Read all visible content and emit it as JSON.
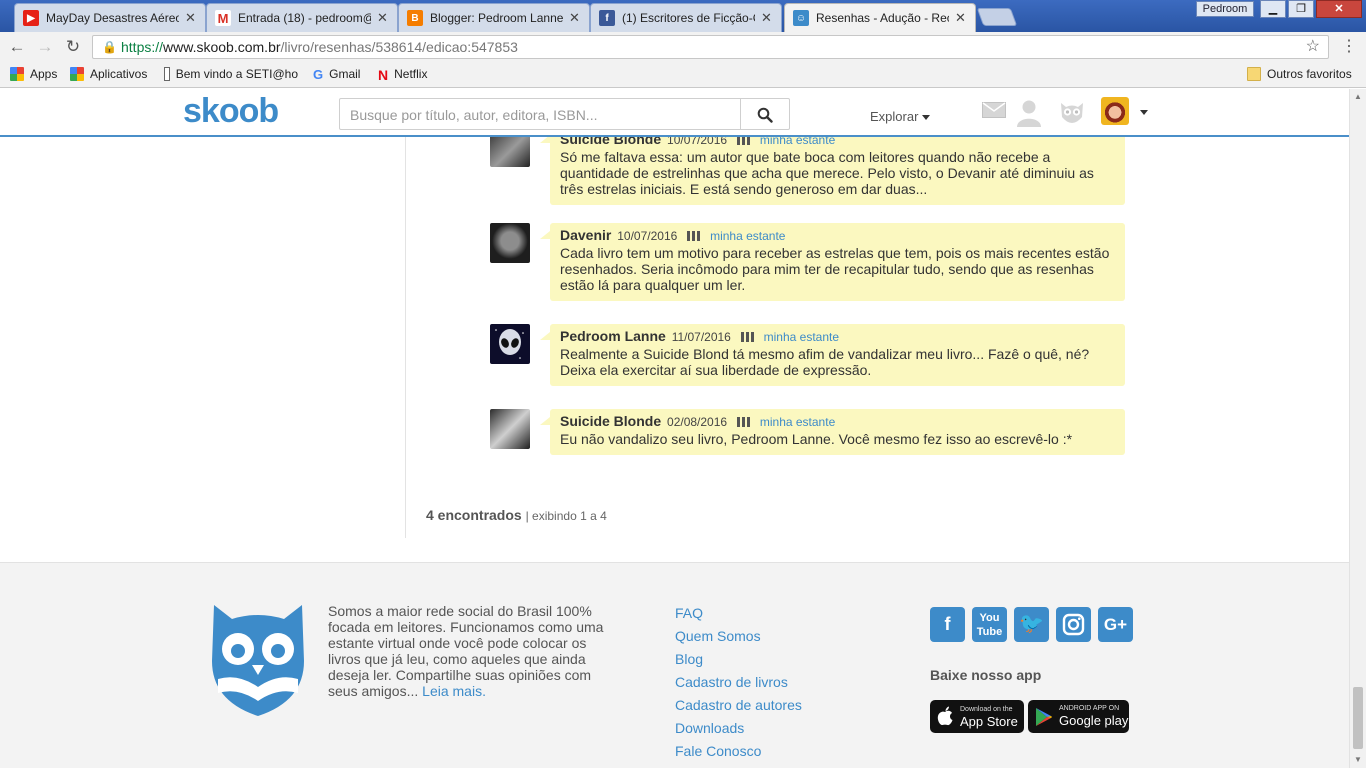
{
  "browser": {
    "tabs": [
      {
        "title": "MayDay Desastres Aéreo",
        "favicon_color": "#e62117",
        "favicon_glyph": "▶"
      },
      {
        "title": "Entrada (18) - pedroom@",
        "favicon_color": "#d93025",
        "favicon_glyph": "M"
      },
      {
        "title": "Blogger: Pedroom Lanne",
        "favicon_color": "#f57d00",
        "favicon_glyph": "B"
      },
      {
        "title": "(1) Escritores de Ficção-C",
        "favicon_color": "#3b5998",
        "favicon_glyph": "f"
      },
      {
        "title": "Resenhas - Adução - Rec",
        "favicon_color": "#3d8bc9",
        "favicon_glyph": "☺"
      }
    ],
    "profile_name": "Pedroom",
    "url": {
      "scheme": "https://",
      "domain": "www.skoob.com.br",
      "path": "/livro/resenhas/538614/edicao:547853"
    },
    "bookmarks": [
      "Apps",
      "Aplicativos",
      "Bem vindo a SETI@ho",
      "Gmail",
      "Netflix"
    ],
    "other_bookmarks": "Outros favoritos"
  },
  "header": {
    "logo": "skoob",
    "search_placeholder": "Busque por título, autor, editora, ISBN...",
    "explore_label": "Explorar"
  },
  "comments": [
    {
      "user": "Suicide Blonde",
      "date": "10/07/2016",
      "shelf_link": "minha estante",
      "text": "Só me faltava essa: um autor que bate boca com leitores quando não recebe a quantidade de estrelinhas que acha que merece. Pelo visto, o Devanir até diminuiu as três estrelas iniciais. E está sendo generoso em dar duas..."
    },
    {
      "user": "Davenir",
      "date": "10/07/2016",
      "shelf_link": "minha estante",
      "text": "Cada livro tem um motivo para receber as estrelas que tem, pois os mais recentes estão resenhados. Seria incômodo para mim ter de recapitular tudo, sendo que as resenhas estão lá para qualquer um ler."
    },
    {
      "user": "Pedroom Lanne",
      "date": "11/07/2016",
      "shelf_link": "minha estante",
      "text": "Realmente a Suicide Blond tá mesmo afim de vandalizar meu livro... Fazê o quê, né? Deixa ela exercitar aí sua liberdade de expressão."
    },
    {
      "user": "Suicide Blonde",
      "date": "02/08/2016",
      "shelf_link": "minha estante",
      "text": "Eu não vandalizo seu livro, Pedroom Lanne. Você mesmo fez isso ao escrevê-lo :*"
    }
  ],
  "results": {
    "count_label": "4 encontrados",
    "range_label": "| exibindo 1 a 4"
  },
  "footer": {
    "about": "Somos a maior rede social do Brasil 100% focada em leitores. Funcionamos como uma estante virtual onde você pode colocar os livros que já leu, como aqueles que ainda deseja ler. Compartilhe suas opiniões com seus amigos...",
    "read_more": "Leia mais.",
    "links": [
      "FAQ",
      "Quem Somos",
      "Blog",
      "Cadastro de livros",
      "Cadastro de autores",
      "Downloads",
      "Fale Conosco"
    ],
    "social": [
      "facebook-icon",
      "youtube-icon",
      "twitter-icon",
      "instagram-icon",
      "google-plus-icon"
    ],
    "app_title": "Baixe nosso app",
    "app_store": {
      "small": "Download on the",
      "big": "App Store"
    },
    "google_play": {
      "small": "ANDROID APP ON",
      "big": "Google play"
    }
  },
  "colors": {
    "brand": "#3d8bc9",
    "bubble": "#fbf8c0"
  }
}
